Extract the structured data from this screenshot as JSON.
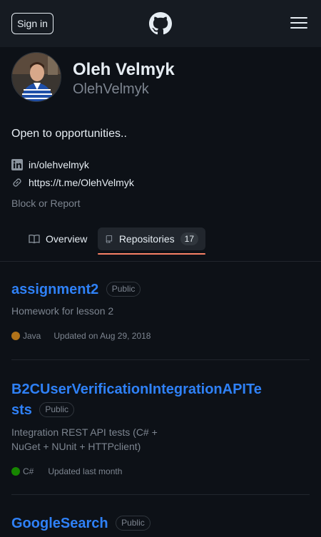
{
  "header": {
    "sign_in_label": "Sign in"
  },
  "profile": {
    "full_name": "Oleh Velmyk",
    "username": "OlehVelmyk",
    "bio": "Open to opportunities..",
    "linkedin": "in/olehvelmyk",
    "website": "https://t.me/OlehVelmyk",
    "block_report": "Block or Report"
  },
  "tabs": {
    "overview": "Overview",
    "repositories": "Repositories",
    "repositories_count": "17"
  },
  "repos": [
    {
      "name": "assignment2",
      "visibility": "Public",
      "description": "Homework for lesson 2",
      "language": "Java",
      "language_color": "#b07219",
      "updated": "Updated on Aug 29, 2018"
    },
    {
      "name_line1": "B2CUserVerificationIntegrationAPITe",
      "name_line2": "sts",
      "visibility": "Public",
      "description_line1": "Integration REST API tests (C# +",
      "description_line2": "NuGet + NUnit + HTTPclient)",
      "language": "C#",
      "language_color": "#178600",
      "updated": "Updated last month"
    },
    {
      "name": "GoogleSearch",
      "visibility": "Public"
    }
  ],
  "colors": {
    "background": "#0d1117",
    "header": "#161b22",
    "link": "#2f81f7",
    "accent_underline": "#f78166",
    "muted": "#7d8590"
  }
}
